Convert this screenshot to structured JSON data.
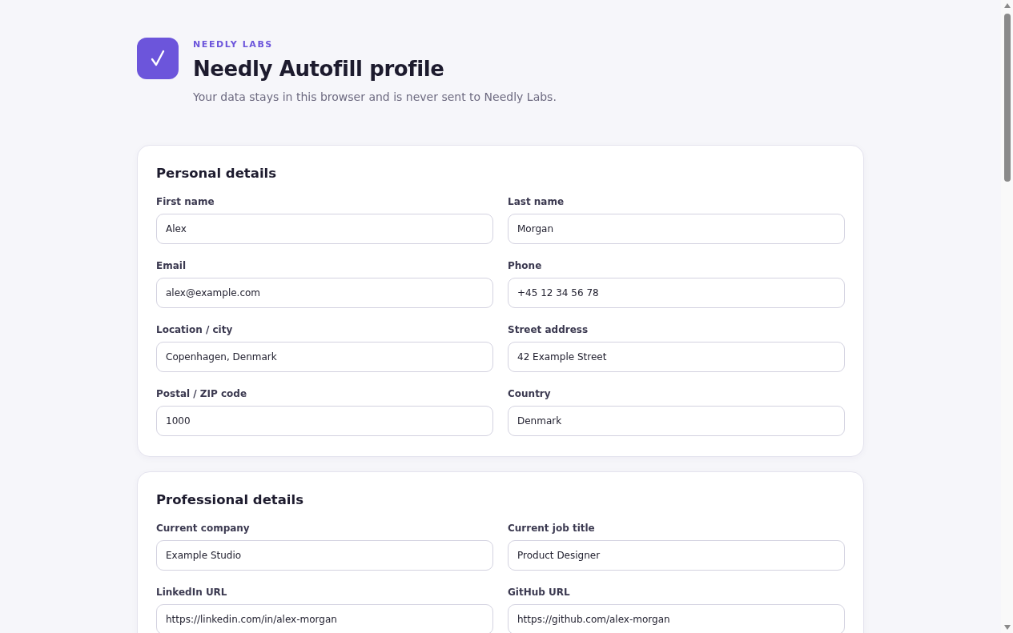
{
  "header": {
    "eyebrow": "NEEDLY LABS",
    "title": "Needly Autofill profile",
    "subtitle": "Your data stays in this browser and is never sent to Needly Labs."
  },
  "sections": [
    {
      "title": "Personal details",
      "fields": [
        {
          "label": "First name",
          "value": "Alex"
        },
        {
          "label": "Last name",
          "value": "Morgan"
        },
        {
          "label": "Email",
          "value": "alex@example.com"
        },
        {
          "label": "Phone",
          "value": "+45 12 34 56 78"
        },
        {
          "label": "Location / city",
          "value": "Copenhagen, Denmark"
        },
        {
          "label": "Street address",
          "value": "42 Example Street"
        },
        {
          "label": "Postal / ZIP code",
          "value": "1000"
        },
        {
          "label": "Country",
          "value": "Denmark"
        }
      ]
    },
    {
      "title": "Professional details",
      "fields": [
        {
          "label": "Current company",
          "value": "Example Studio"
        },
        {
          "label": "Current job title",
          "value": "Product Designer"
        },
        {
          "label": "LinkedIn URL",
          "value": "https://linkedin.com/in/alex-morgan"
        },
        {
          "label": "GitHub URL",
          "value": "https://github.com/alex-morgan"
        }
      ]
    }
  ]
}
